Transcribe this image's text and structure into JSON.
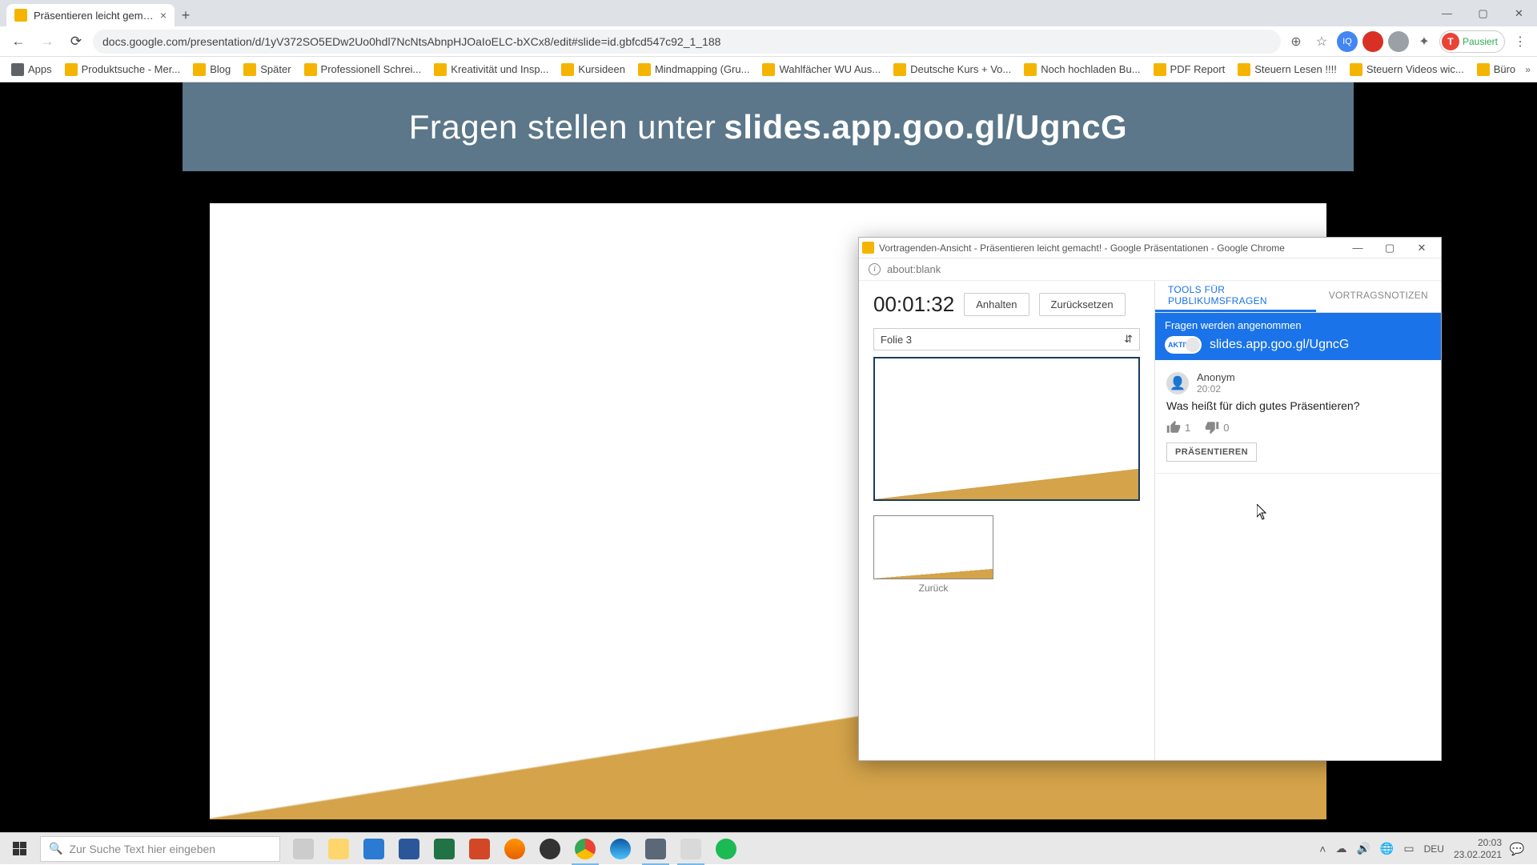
{
  "browser": {
    "tab": {
      "title": "Präsentieren leicht gemacht! - G"
    },
    "url": "docs.google.com/presentation/d/1yV372SO5EDw2Uo0hdl7NcNtsAbnpHJOaIoELC-bXCx8/edit#slide=id.gbfcd547c92_1_188",
    "profile_label": "Pausiert",
    "profile_letter": "T"
  },
  "bookmarks": [
    "Apps",
    "Produktsuche - Mer...",
    "Blog",
    "Später",
    "Professionell Schrei...",
    "Kreativität und Insp...",
    "Kursideen",
    "Mindmapping (Gru...",
    "Wahlfächer WU Aus...",
    "Deutsche Kurs + Vo...",
    "Noch hochladen Bu...",
    "PDF Report",
    "Steuern Lesen !!!!",
    "Steuern Videos wic...",
    "Büro"
  ],
  "banner": {
    "light": "Fragen stellen unter",
    "bold": "slides.app.goo.gl/UgncG"
  },
  "popup": {
    "title": "Vortragenden-Ansicht - Präsentieren leicht gemacht! - Google Präsentationen - Google Chrome",
    "addr": "about:blank",
    "timer": "00:01:32",
    "btn_pause": "Anhalten",
    "btn_reset": "Zurücksetzen",
    "slide_select": "Folie 3",
    "prev_label": "Zurück",
    "tabs": {
      "qa": "TOOLS FÜR PUBLIKUMSFRAGEN",
      "notes": "VORTRAGSNOTIZEN"
    },
    "qa": {
      "status": "Fragen werden angenommen",
      "toggle": "AKTIVIE",
      "url": "slides.app.goo.gl/UgncG",
      "question": {
        "user": "Anonym",
        "time": "20:02",
        "text": "Was heißt für dich gutes Präsentieren?",
        "up": "1",
        "down": "0",
        "present_btn": "PRÄSENTIEREN"
      }
    }
  },
  "taskbar": {
    "search_placeholder": "Zur Suche Text hier eingeben",
    "lang": "DEU",
    "time": "20:03",
    "date": "23.02.2021"
  }
}
